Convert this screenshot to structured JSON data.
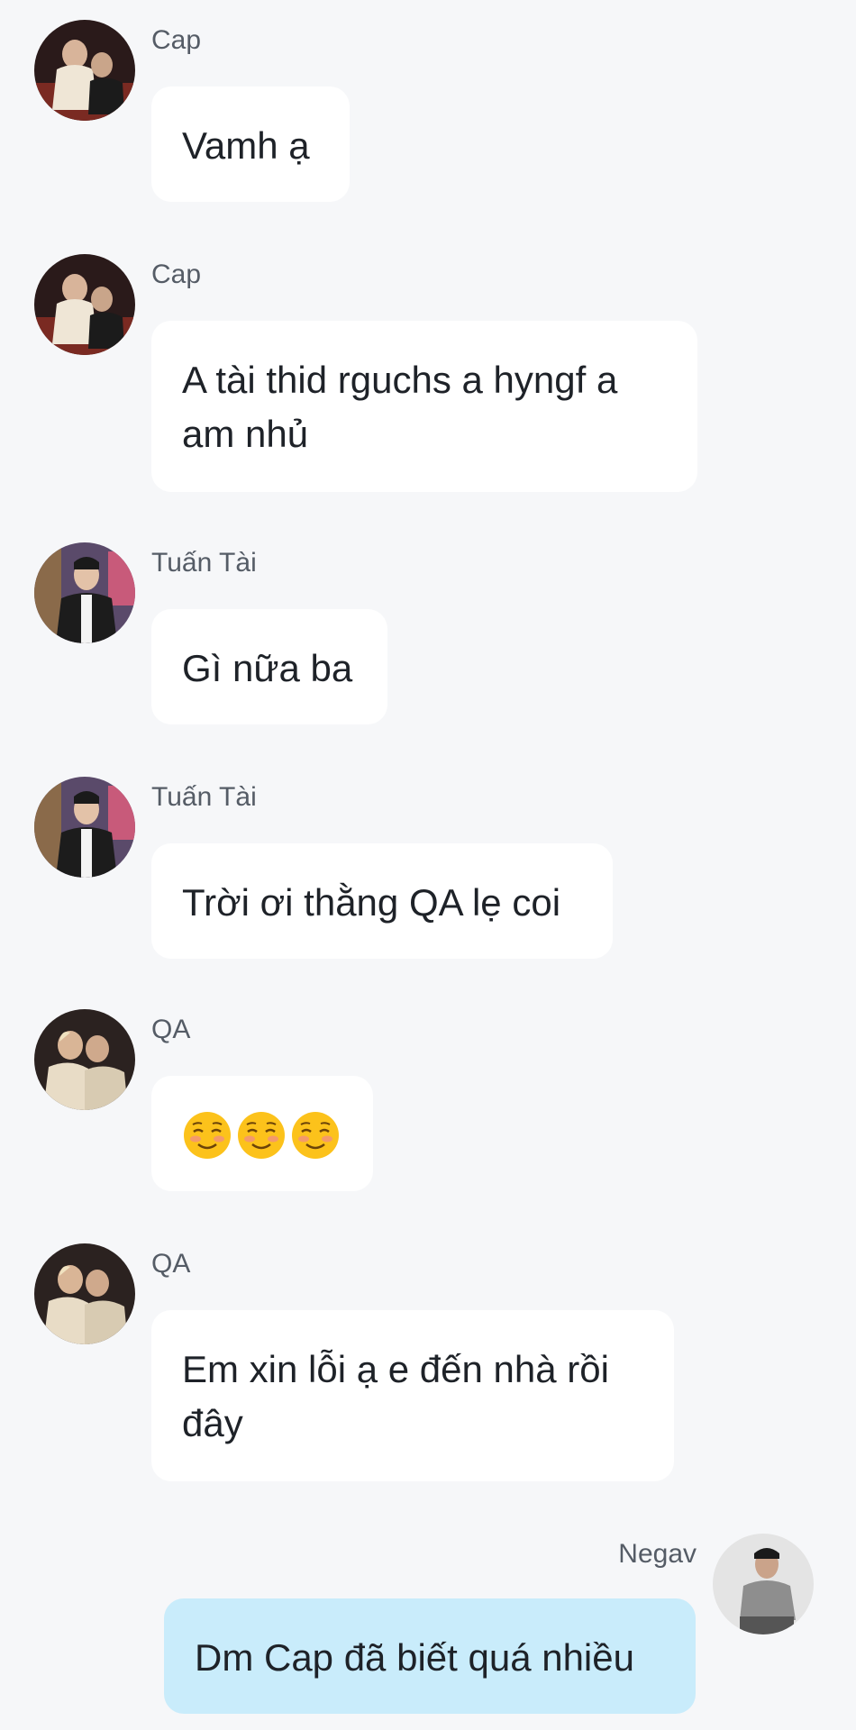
{
  "messages": [
    {
      "sender": "Cap",
      "text": "Vamh ạ",
      "avatar_icon": "cap-avatar"
    },
    {
      "sender": "Cap",
      "text": "A tài thid rguchs a hyngf a am nhủ",
      "avatar_icon": "cap-avatar"
    },
    {
      "sender": "Tuấn Tài",
      "text": "Gì nữa ba",
      "avatar_icon": "tuan-tai-avatar"
    },
    {
      "sender": "Tuấn Tài",
      "text": "Trời ơi thằng QA lẹ coi",
      "avatar_icon": "tuan-tai-avatar"
    },
    {
      "sender": "QA",
      "text": "☺️☺️☺️",
      "avatar_icon": "qa-avatar"
    },
    {
      "sender": "QA",
      "text": "Em xin lỗi ạ e đến nhà rồi đây",
      "avatar_icon": "qa-avatar"
    },
    {
      "sender": "Negav",
      "text": "Dm Cap đã biết quá nhiều",
      "avatar_icon": "negav-avatar",
      "mine": true
    }
  ],
  "colors": {
    "background": "#f6f7f9",
    "bubble_incoming": "#ffffff",
    "bubble_outgoing": "#c9ecfb",
    "sender_text": "#555c66",
    "message_text": "#1e2228"
  }
}
